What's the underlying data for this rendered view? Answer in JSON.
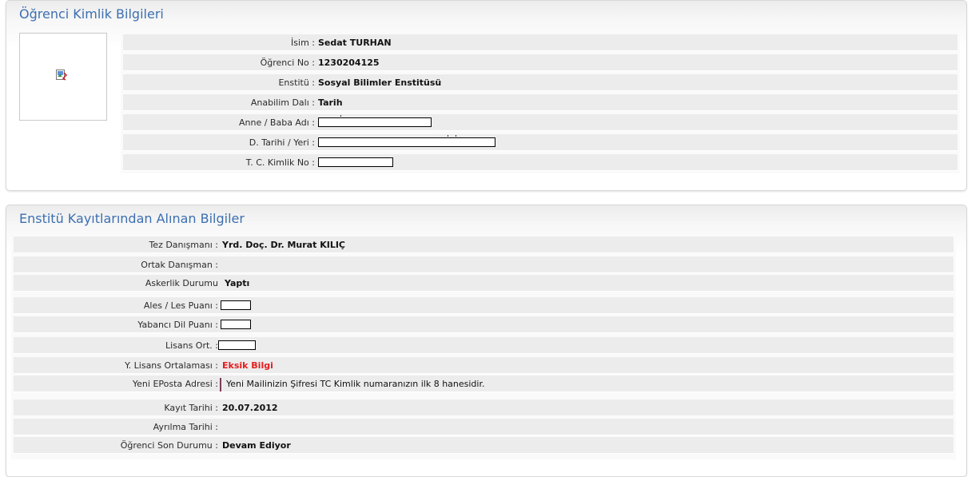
{
  "identity": {
    "title": "Öğrenci Kimlik Bilgileri",
    "photo_icon": "broken-image-icon",
    "rows": [
      {
        "label": "İsim :",
        "value": "Sedat TURHAN"
      },
      {
        "label": "Öğrenci No :",
        "value": "1230204125"
      },
      {
        "label": "Enstitü :",
        "value": "Sosyal Bilimler Enstitüsü"
      },
      {
        "label": "Anabilim Dalı :",
        "value": "Tarih"
      },
      {
        "label": "Anne / Baba Adı :",
        "value": ""
      },
      {
        "label": "D. Tarihi / Yeri :",
        "value": ""
      },
      {
        "label": "T. C. Kimlik No :",
        "value": ""
      }
    ]
  },
  "registry": {
    "title": "Enstitü Kayıtlarından Alınan Bilgiler",
    "rows": [
      {
        "label": "Tez Danışmanı :",
        "value": "Yrd. Doç. Dr. Murat KILIÇ"
      },
      {
        "label": "Ortak Danışman :",
        "value": ""
      },
      {
        "label": "Askerlik Durumu",
        "value": "Yaptı"
      },
      {
        "label": "Ales / Les Puanı :",
        "value": ""
      },
      {
        "label": "Yabancı Dil Puanı :",
        "value": ""
      },
      {
        "label": "Lisans Ort. :",
        "value": ""
      },
      {
        "label": "Y. Lisans Ortalaması :",
        "value": "Eksik Bilgi"
      },
      {
        "label": "Yeni EPosta Adresi :",
        "value": "Yeni Mailinizin Şifresi TC Kimlik numaranızın ilk 8 hanesidir."
      },
      {
        "label": "Kayıt Tarihi :",
        "value": "20.07.2012"
      },
      {
        "label": "Ayrılma Tarihi :",
        "value": ""
      },
      {
        "label": "Öğrenci Son Durumu :",
        "value": "Devam Ediyor"
      }
    ]
  },
  "colors": {
    "title": "#3c6fb0",
    "warning": "#e31e1e",
    "row_bg": "#ececec"
  }
}
